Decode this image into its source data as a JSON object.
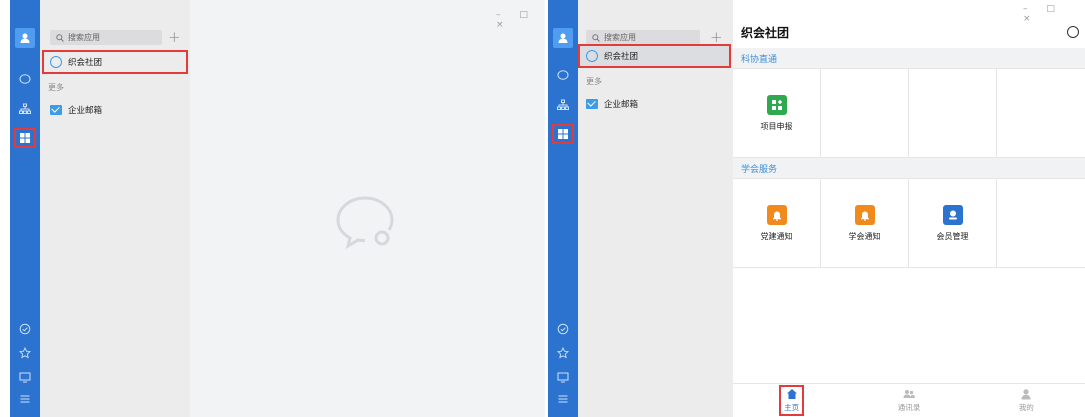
{
  "left_window": {
    "search_placeholder": "搜索应用",
    "plus": "+",
    "app_item": "织会社团",
    "more_label": "更多",
    "mail_item": "企业邮箱",
    "window_controls": "– □ ×"
  },
  "right_window": {
    "search_placeholder": "搜索应用",
    "plus": "+",
    "app_item": "织会社团",
    "more_label": "更多",
    "mail_item": "企业邮箱",
    "window_controls": "– □ ×"
  },
  "app": {
    "title": "织会社团",
    "sections": [
      {
        "name": "科协直通",
        "items": [
          {
            "label": "项目申报",
            "icon": "project-report-icon",
            "color": "#2fa84f"
          },
          {
            "label": "",
            "icon": "",
            "color": ""
          },
          {
            "label": "",
            "icon": "",
            "color": ""
          },
          {
            "label": "",
            "icon": "",
            "color": ""
          }
        ]
      },
      {
        "name": "学会服务",
        "items": [
          {
            "label": "党建通知",
            "icon": "bell-icon",
            "color": "#f08a1c"
          },
          {
            "label": "学会通知",
            "icon": "bell-icon",
            "color": "#f08a1c"
          },
          {
            "label": "会员管理",
            "icon": "member-icon",
            "color": "#2b73ce"
          },
          {
            "label": "",
            "icon": "",
            "color": ""
          }
        ]
      }
    ],
    "tabs": [
      {
        "label": "主页",
        "icon": "home-icon",
        "active": true
      },
      {
        "label": "通讯录",
        "icon": "contacts-icon",
        "active": false
      },
      {
        "label": "我的",
        "icon": "user-icon",
        "active": false
      }
    ]
  },
  "colors": {
    "rail": "#2b73ce",
    "highlight": "#e23b3b",
    "accent": "#3b8ed8"
  }
}
